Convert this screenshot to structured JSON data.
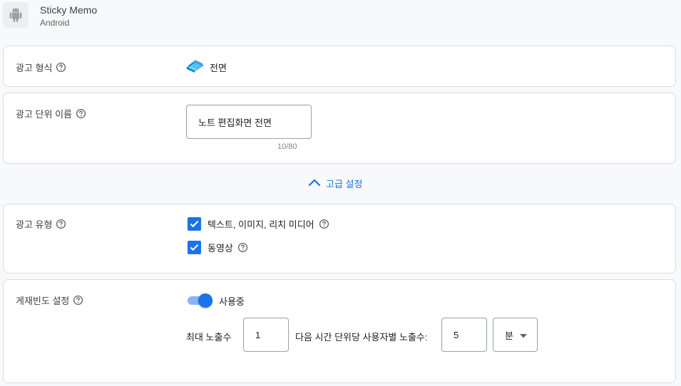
{
  "app": {
    "name": "Sticky Memo",
    "platform": "Android",
    "icon": "android-icon"
  },
  "ad_format": {
    "label": "광고 형식",
    "value": "전면",
    "icon": "book-stack-icon"
  },
  "ad_unit_name": {
    "label": "광고 단위 이름",
    "value": "노트 편집화면 전면",
    "char_count": "10/80"
  },
  "advanced": {
    "label": "고급 설정",
    "expanded": true
  },
  "ad_type": {
    "label": "광고 유형",
    "options": [
      {
        "label": "텍스트, 이미지, 리치 미디어",
        "checked": true
      },
      {
        "label": "동영상",
        "checked": true
      }
    ]
  },
  "frequency": {
    "label": "게재빈도 설정",
    "toggle_label": "사용중",
    "enabled": true,
    "max_label": "최대 노출수",
    "max_value": "1",
    "per_label": "다음 시간 단위당 사용자별 노출수:",
    "time_value": "5",
    "unit_value": "분"
  },
  "colors": {
    "accent": "#1a73e8",
    "toggle_track": "#8ab4f8",
    "border": "#dadce0",
    "background": "#f8f9fa"
  }
}
